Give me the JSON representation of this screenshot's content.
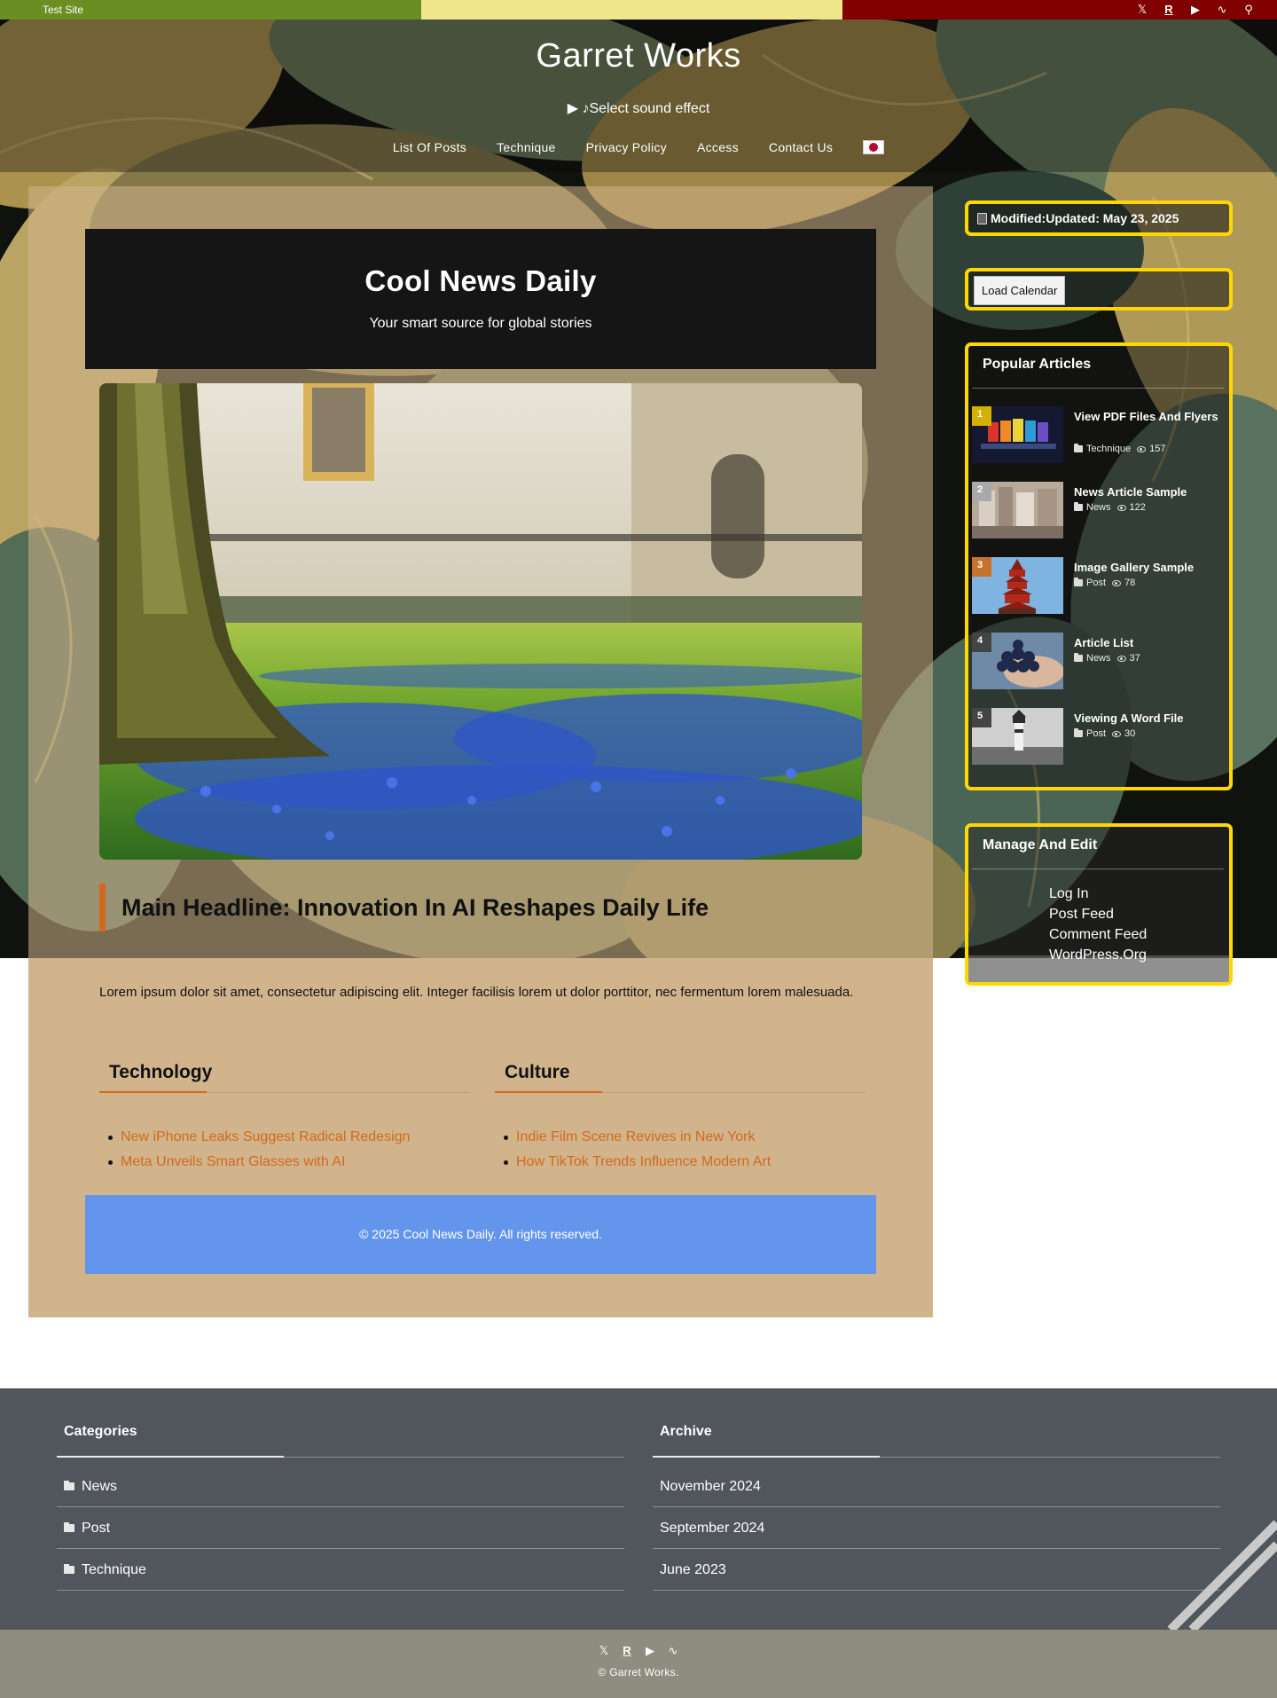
{
  "topbar": {
    "site_label": "Test Site",
    "icons": [
      "x-icon",
      "r-icon",
      "youtube-icon",
      "rss-icon",
      "search-icon"
    ]
  },
  "header": {
    "site_title": "Garret Works",
    "sound_label": "▶ ♪Select sound effect",
    "nav": [
      "List Of Posts",
      "Technique",
      "Privacy Policy",
      "Access",
      "Contact Us"
    ]
  },
  "main": {
    "news_title": "Cool News Daily",
    "news_tagline": "Your smart source for global stories",
    "headline": "Main Headline: Innovation In AI Reshapes Daily Life",
    "lead": "Lorem ipsum dolor sit amet, consectetur adipiscing elit. Integer facilisis lorem ut dolor porttitor, nec fermentum lorem malesuada.",
    "columns": [
      {
        "title": "Technology",
        "items": [
          "New iPhone Leaks Suggest Radical Redesign",
          "Meta Unveils Smart Glasses with AI"
        ]
      },
      {
        "title": "Culture",
        "items": [
          "Indie Film Scene Revives in New York",
          "How TikTok Trends Influence Modern Art"
        ]
      }
    ],
    "footer_text": "© 2025 Cool News Daily. All rights reserved."
  },
  "sidebar": {
    "modified": "Modified:Updated: May 23, 2025",
    "calendar_button": "Load Calendar",
    "popular_title": "Popular Articles",
    "popular": [
      {
        "rank": "1",
        "title": "View PDF Files And Flyers",
        "category": "Technique",
        "views": "157",
        "rank_color": "#d4b000"
      },
      {
        "rank": "2",
        "title": "News Article Sample",
        "category": "News",
        "views": "122",
        "rank_color": "#a9a9a9"
      },
      {
        "rank": "3",
        "title": "Image Gallery Sample",
        "category": "Post",
        "views": "78",
        "rank_color": "#c8732b"
      },
      {
        "rank": "4",
        "title": "Article List",
        "category": "News",
        "views": "37",
        "rank_color": "#444444"
      },
      {
        "rank": "5",
        "title": "Viewing A Word File",
        "category": "Post",
        "views": "30",
        "rank_color": "#444444"
      }
    ],
    "manage_title": "Manage And Edit",
    "manage_links": [
      "Log In",
      "Post Feed",
      "Comment Feed",
      "WordPress.Org"
    ]
  },
  "footer": {
    "categories_title": "Categories",
    "categories": [
      "News",
      "Post",
      "Technique"
    ],
    "archive_title": "Archive",
    "archive": [
      "November 2024",
      "September 2024",
      "June 2023"
    ],
    "copyright": "© Garret Works.",
    "icons": [
      "x-icon",
      "r-icon",
      "youtube-icon",
      "rss-icon"
    ]
  },
  "colors": {
    "accent": "#d2691e",
    "widget_border": "#ffd700",
    "news_footer": "#6495ed",
    "main_bg": "#d2b48c",
    "footer_bg": "#51555c",
    "copyright_bg": "#8f8d80"
  }
}
